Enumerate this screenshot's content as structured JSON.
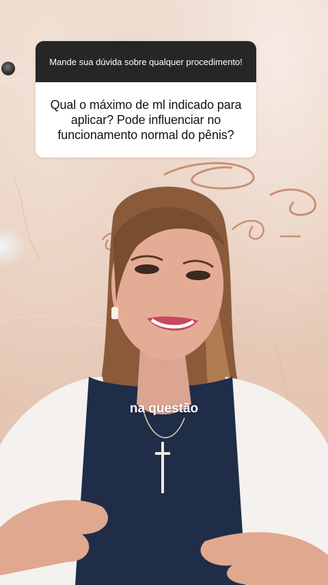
{
  "question_box": {
    "prompt": "Mande sua dúvida sobre qualquer procedimento!",
    "question": "Qual o máximo de ml indicado para aplicar? Pode influenciar no funcionamento normal do pênis?"
  },
  "caption": {
    "text": "na questão"
  },
  "colors": {
    "card_header_bg": "#262626",
    "card_body_bg": "#ffffff",
    "caption_text": "#ffffff",
    "wall_tone": "#e7cbb9",
    "signage_copper": "#c99076",
    "blouse_navy": "#1f2d48",
    "blazer_white": "#f4f1ee",
    "hair_brown": "#8a5a3a"
  }
}
